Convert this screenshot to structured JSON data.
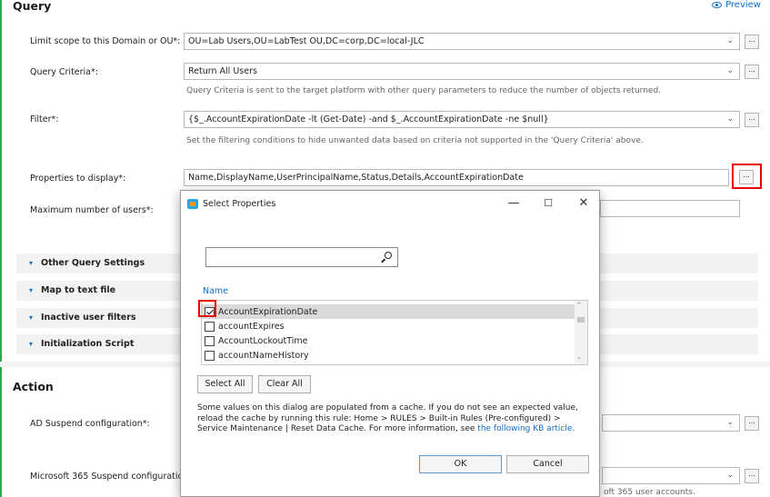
{
  "query": {
    "title": "Query",
    "preview_label": "Preview",
    "scope_label": "Limit scope to this Domain or OU*:",
    "scope_value": "OU=Lab Users,OU=LabTest OU,DC=corp,DC=local-JLC",
    "criteria_label": "Query Criteria*:",
    "criteria_value": "Return All Users",
    "criteria_hint": "Query Criteria is sent to the target platform with other query parameters to reduce the number of objects returned.",
    "filter_label": "Filter*:",
    "filter_value": "{$_.AccountExpirationDate -lt (Get-Date) -and $_.AccountExpirationDate -ne $null}",
    "filter_hint": "Set the filtering conditions to hide unwanted data based on criteria not supported in the 'Query Criteria' above.",
    "props_label": "Properties to display*:",
    "props_value": "Name,DisplayName,UserPrincipalName,Status,Details,AccountExpirationDate",
    "max_label": "Maximum number of users*:",
    "max_value": "",
    "sections": [
      "Other Query Settings",
      "Map to text file",
      "Inactive user filters",
      "Initialization Script"
    ]
  },
  "action": {
    "title": "Action",
    "ad_label": "AD Suspend configuration*:",
    "ms_label": "Microsoft 365 Suspend configuration",
    "ms_hint": "oft 365 user accounts."
  },
  "dialog": {
    "title": "Select Properties",
    "min": "—",
    "max": "☐",
    "close": "✕",
    "search_value": "",
    "column": "Name",
    "items": [
      {
        "label": "AccountExpirationDate",
        "checked": true
      },
      {
        "label": "accountExpires",
        "checked": false
      },
      {
        "label": "AccountLockoutTime",
        "checked": false
      },
      {
        "label": "accountNameHistory",
        "checked": false
      }
    ],
    "select_all": "Select All",
    "clear_all": "Clear All",
    "info_text": "Some values on this dialog are populated from a cache. If you do not see an expected value, reload the cache by running this rule: Home > RULES > Built-in Rules (Pre-configured) > Service Maintenance | Reset Data Cache. For more information, see ",
    "info_link": "the following KB article.",
    "ok": "OK",
    "cancel": "Cancel"
  },
  "glyphs": {
    "chevron": "⌄",
    "ellipsis": "...",
    "expand": "▾",
    "scroll_up": "^",
    "scroll_down": "⌄"
  },
  "colors": {
    "accent": "#0e6fc7",
    "highlight_border": "#ee0000",
    "panel_edge": "#2ea84a"
  }
}
